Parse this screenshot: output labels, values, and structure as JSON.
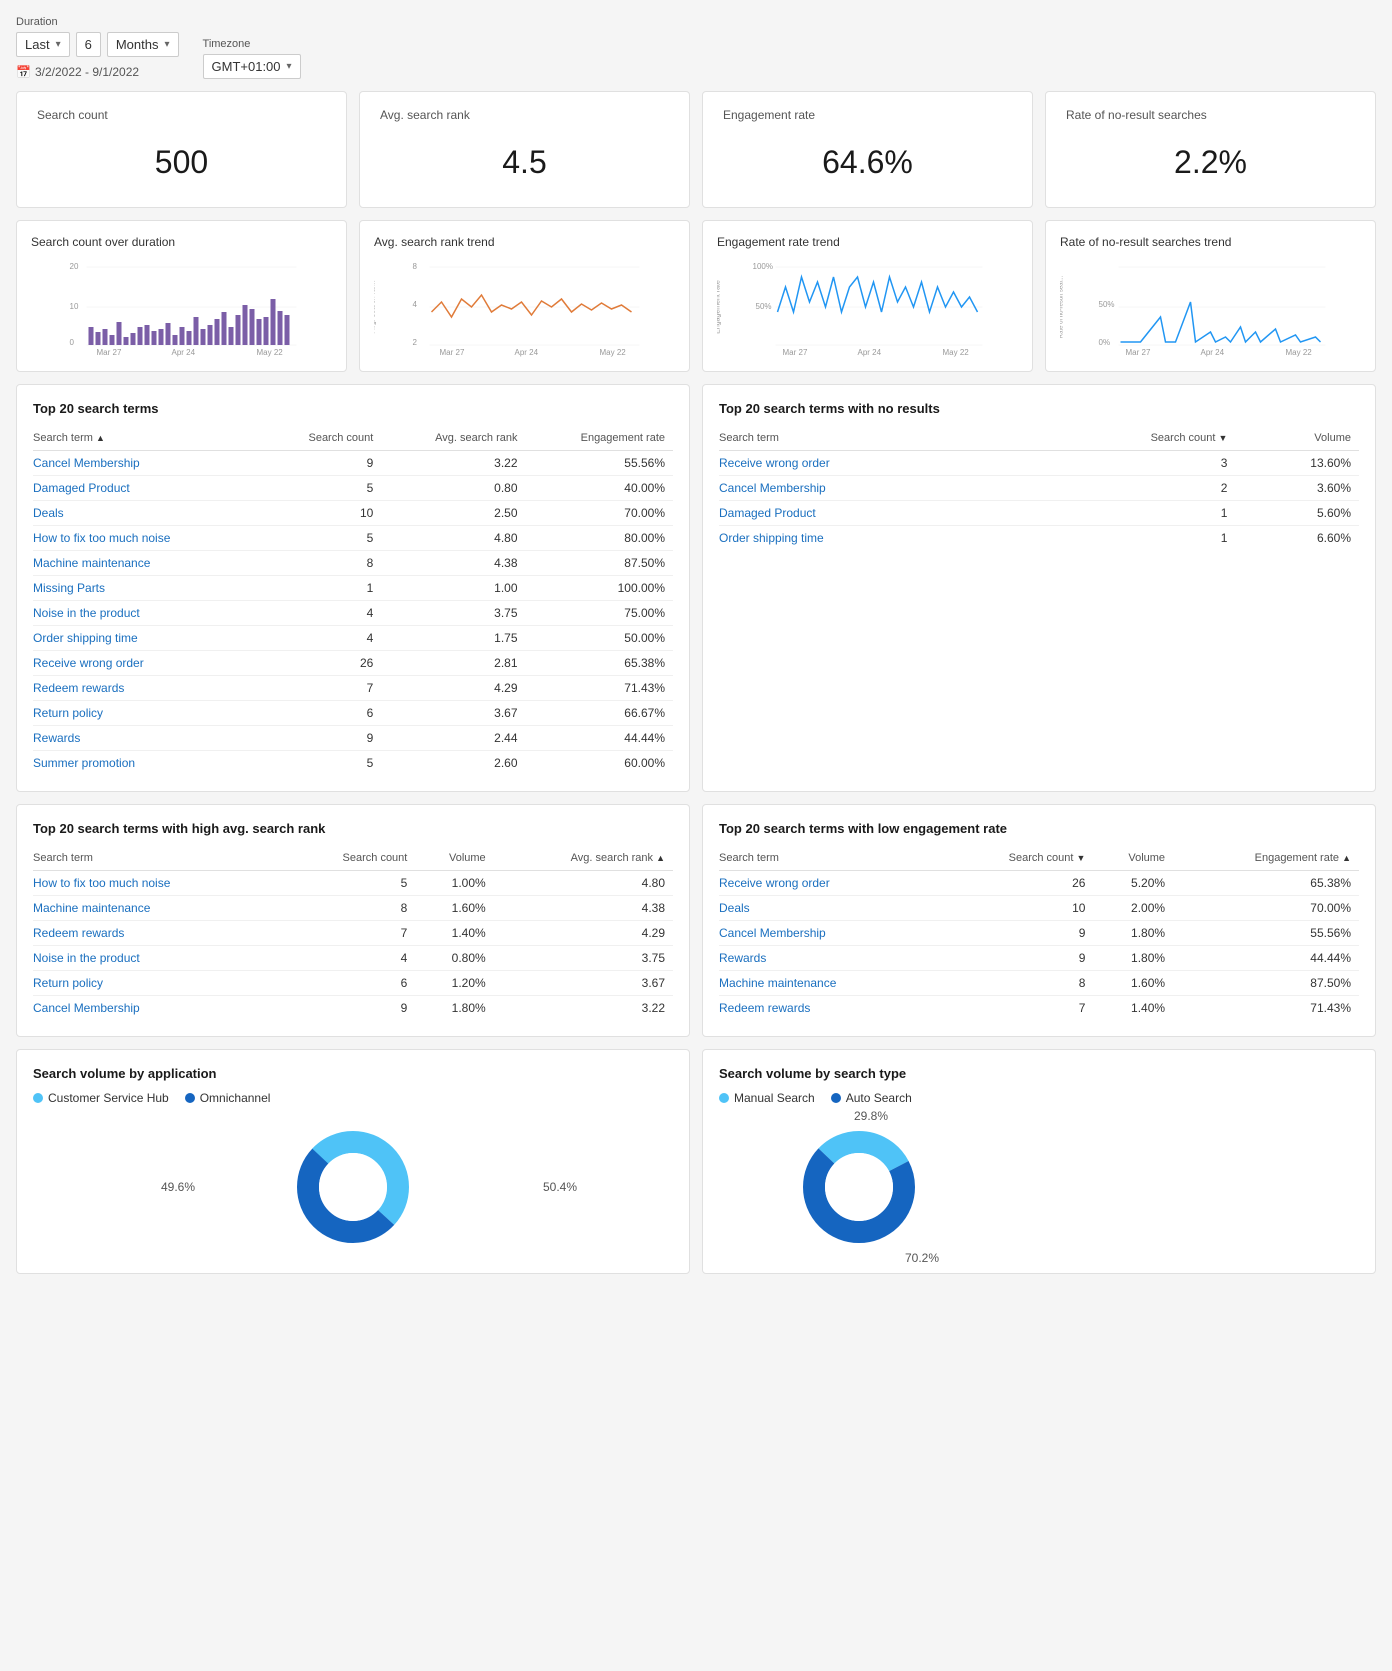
{
  "controls": {
    "duration_label": "Duration",
    "timezone_label": "Timezone",
    "period_type": "Last",
    "period_value": "6",
    "period_unit": "Months",
    "timezone_value": "GMT+01:00",
    "date_range": "3/2/2022 - 9/1/2022"
  },
  "kpis": [
    {
      "title": "Search count",
      "value": "500"
    },
    {
      "title": "Avg. search rank",
      "value": "4.5"
    },
    {
      "title": "Engagement rate",
      "value": "64.6%"
    },
    {
      "title": "Rate of no-result searches",
      "value": "2.2%"
    }
  ],
  "charts": [
    {
      "title": "Search count over duration",
      "color": "#7B5EA7",
      "type": "bar"
    },
    {
      "title": "Avg. search rank trend",
      "color": "#E07B39",
      "type": "line"
    },
    {
      "title": "Engagement rate trend",
      "color": "#2196F3",
      "type": "line"
    },
    {
      "title": "Rate of no-result searches trend",
      "color": "#2196F3",
      "type": "line"
    }
  ],
  "top20_terms": {
    "title": "Top 20 search terms",
    "columns": [
      "Search term",
      "Search count",
      "Avg. search rank",
      "Engagement rate"
    ],
    "rows": [
      {
        "term": "Cancel Membership",
        "count": 9,
        "rank": "3.22",
        "engagement": "55.56%"
      },
      {
        "term": "Damaged Product",
        "count": 5,
        "rank": "0.80",
        "engagement": "40.00%"
      },
      {
        "term": "Deals",
        "count": 10,
        "rank": "2.50",
        "engagement": "70.00%"
      },
      {
        "term": "How to fix too much noise",
        "count": 5,
        "rank": "4.80",
        "engagement": "80.00%"
      },
      {
        "term": "Machine maintenance",
        "count": 8,
        "rank": "4.38",
        "engagement": "87.50%"
      },
      {
        "term": "Missing Parts",
        "count": 1,
        "rank": "1.00",
        "engagement": "100.00%"
      },
      {
        "term": "Noise in the product",
        "count": 4,
        "rank": "3.75",
        "engagement": "75.00%"
      },
      {
        "term": "Order shipping time",
        "count": 4,
        "rank": "1.75",
        "engagement": "50.00%"
      },
      {
        "term": "Receive wrong order",
        "count": 26,
        "rank": "2.81",
        "engagement": "65.38%"
      },
      {
        "term": "Redeem rewards",
        "count": 7,
        "rank": "4.29",
        "engagement": "71.43%"
      },
      {
        "term": "Return policy",
        "count": 6,
        "rank": "3.67",
        "engagement": "66.67%"
      },
      {
        "term": "Rewards",
        "count": 9,
        "rank": "2.44",
        "engagement": "44.44%"
      },
      {
        "term": "Summer promotion",
        "count": 5,
        "rank": "2.60",
        "engagement": "60.00%"
      }
    ]
  },
  "top20_no_results": {
    "title": "Top 20 search terms with no results",
    "columns": [
      "Search term",
      "Search count",
      "Volume"
    ],
    "rows": [
      {
        "term": "Receive wrong order",
        "count": 3,
        "volume": "13.60%"
      },
      {
        "term": "Cancel Membership",
        "count": 2,
        "volume": "3.60%"
      },
      {
        "term": "Damaged Product",
        "count": 1,
        "volume": "5.60%"
      },
      {
        "term": "Order shipping time",
        "count": 1,
        "volume": "6.60%"
      }
    ]
  },
  "top20_high_rank": {
    "title": "Top 20 search terms with high avg. search rank",
    "columns": [
      "Search term",
      "Search count",
      "Volume",
      "Avg. search rank"
    ],
    "rows": [
      {
        "term": "How to fix too much noise",
        "count": 5,
        "volume": "1.00%",
        "rank": "4.80"
      },
      {
        "term": "Machine maintenance",
        "count": 8,
        "volume": "1.60%",
        "rank": "4.38"
      },
      {
        "term": "Redeem rewards",
        "count": 7,
        "volume": "1.40%",
        "rank": "4.29"
      },
      {
        "term": "Noise in the product",
        "count": 4,
        "volume": "0.80%",
        "rank": "3.75"
      },
      {
        "term": "Return policy",
        "count": 6,
        "volume": "1.20%",
        "rank": "3.67"
      },
      {
        "term": "Cancel Membership",
        "count": 9,
        "volume": "1.80%",
        "rank": "3.22"
      }
    ]
  },
  "top20_low_engagement": {
    "title": "Top 20 search terms with low engagement rate",
    "columns": [
      "Search term",
      "Search count",
      "Volume",
      "Engagement rate"
    ],
    "rows": [
      {
        "term": "Receive wrong order",
        "count": 26,
        "volume": "5.20%",
        "engagement": "65.38%"
      },
      {
        "term": "Deals",
        "count": 10,
        "volume": "2.00%",
        "engagement": "70.00%"
      },
      {
        "term": "Cancel Membership",
        "count": 9,
        "volume": "1.80%",
        "engagement": "55.56%"
      },
      {
        "term": "Rewards",
        "count": 9,
        "volume": "1.80%",
        "engagement": "44.44%"
      },
      {
        "term": "Machine maintenance",
        "count": 8,
        "volume": "1.60%",
        "engagement": "87.50%"
      },
      {
        "term": "Redeem rewards",
        "count": 7,
        "volume": "1.40%",
        "engagement": "71.43%"
      }
    ]
  },
  "donut_application": {
    "title": "Search volume by application",
    "legend": [
      {
        "label": "Customer Service Hub",
        "color": "#4FC3F7"
      },
      {
        "label": "Omnichannel",
        "color": "#1565C0"
      }
    ],
    "values": [
      {
        "label": "49.6%",
        "percent": 49.6,
        "color": "#4FC3F7"
      },
      {
        "label": "50.4%",
        "percent": 50.4,
        "color": "#1565C0"
      }
    ],
    "label_left": "49.6%",
    "label_right": "50.4%"
  },
  "donut_search_type": {
    "title": "Search volume by search type",
    "legend": [
      {
        "label": "Manual Search",
        "color": "#4FC3F7"
      },
      {
        "label": "Auto Search",
        "color": "#1565C0"
      }
    ],
    "values": [
      {
        "label": "29.8%",
        "percent": 29.8,
        "color": "#4FC3F7"
      },
      {
        "label": "70.2%",
        "percent": 70.2,
        "color": "#1565C0"
      }
    ],
    "label_top": "29.8%",
    "label_bottom": "70.2%"
  }
}
